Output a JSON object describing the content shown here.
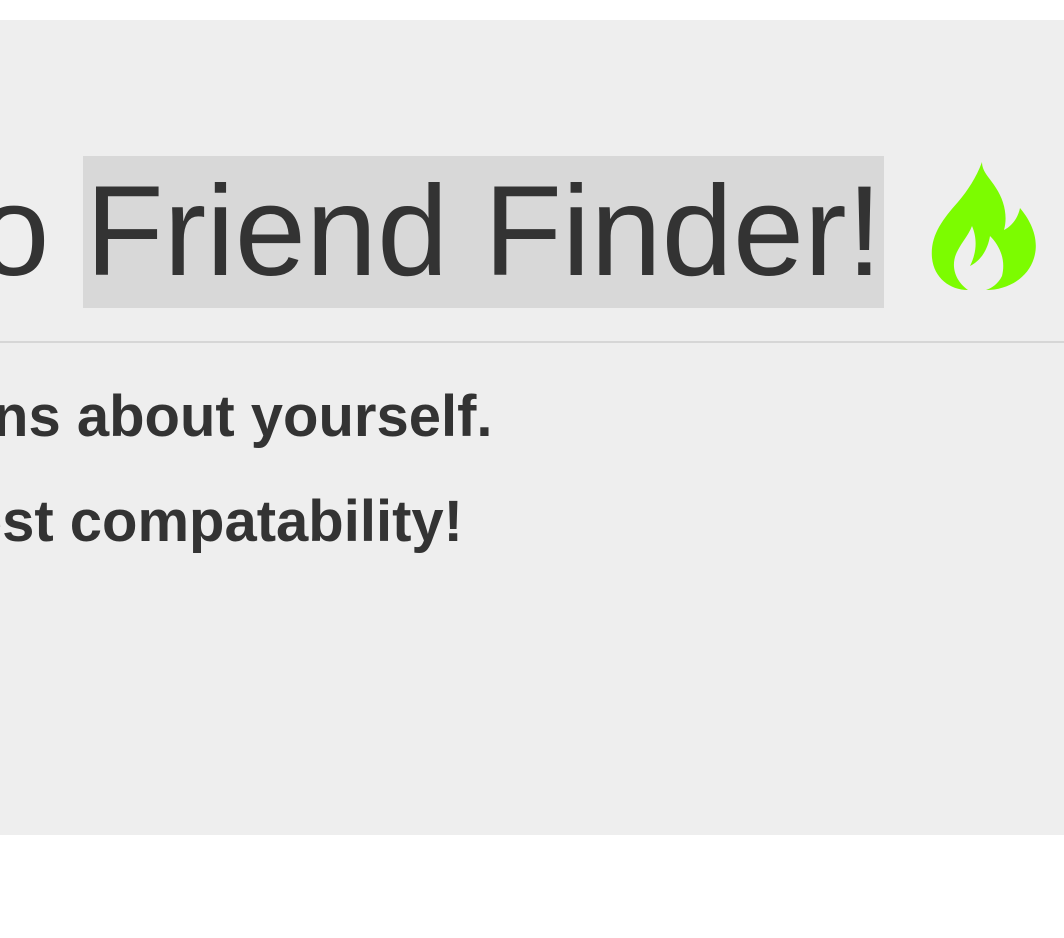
{
  "header": {
    "title_prefix": "Welcome to",
    "title_highlight": "Friend Finder!",
    "icon": "fire-icon",
    "icon_color": "#7cfc00"
  },
  "lead": {
    "line1": "Answer a few questions about yourself.",
    "line2": "We will match you with the greatest compatability!"
  },
  "colors": {
    "jumbotron_bg": "#eeeeee",
    "highlight_bg": "#d8d8d8",
    "text": "#333333"
  }
}
